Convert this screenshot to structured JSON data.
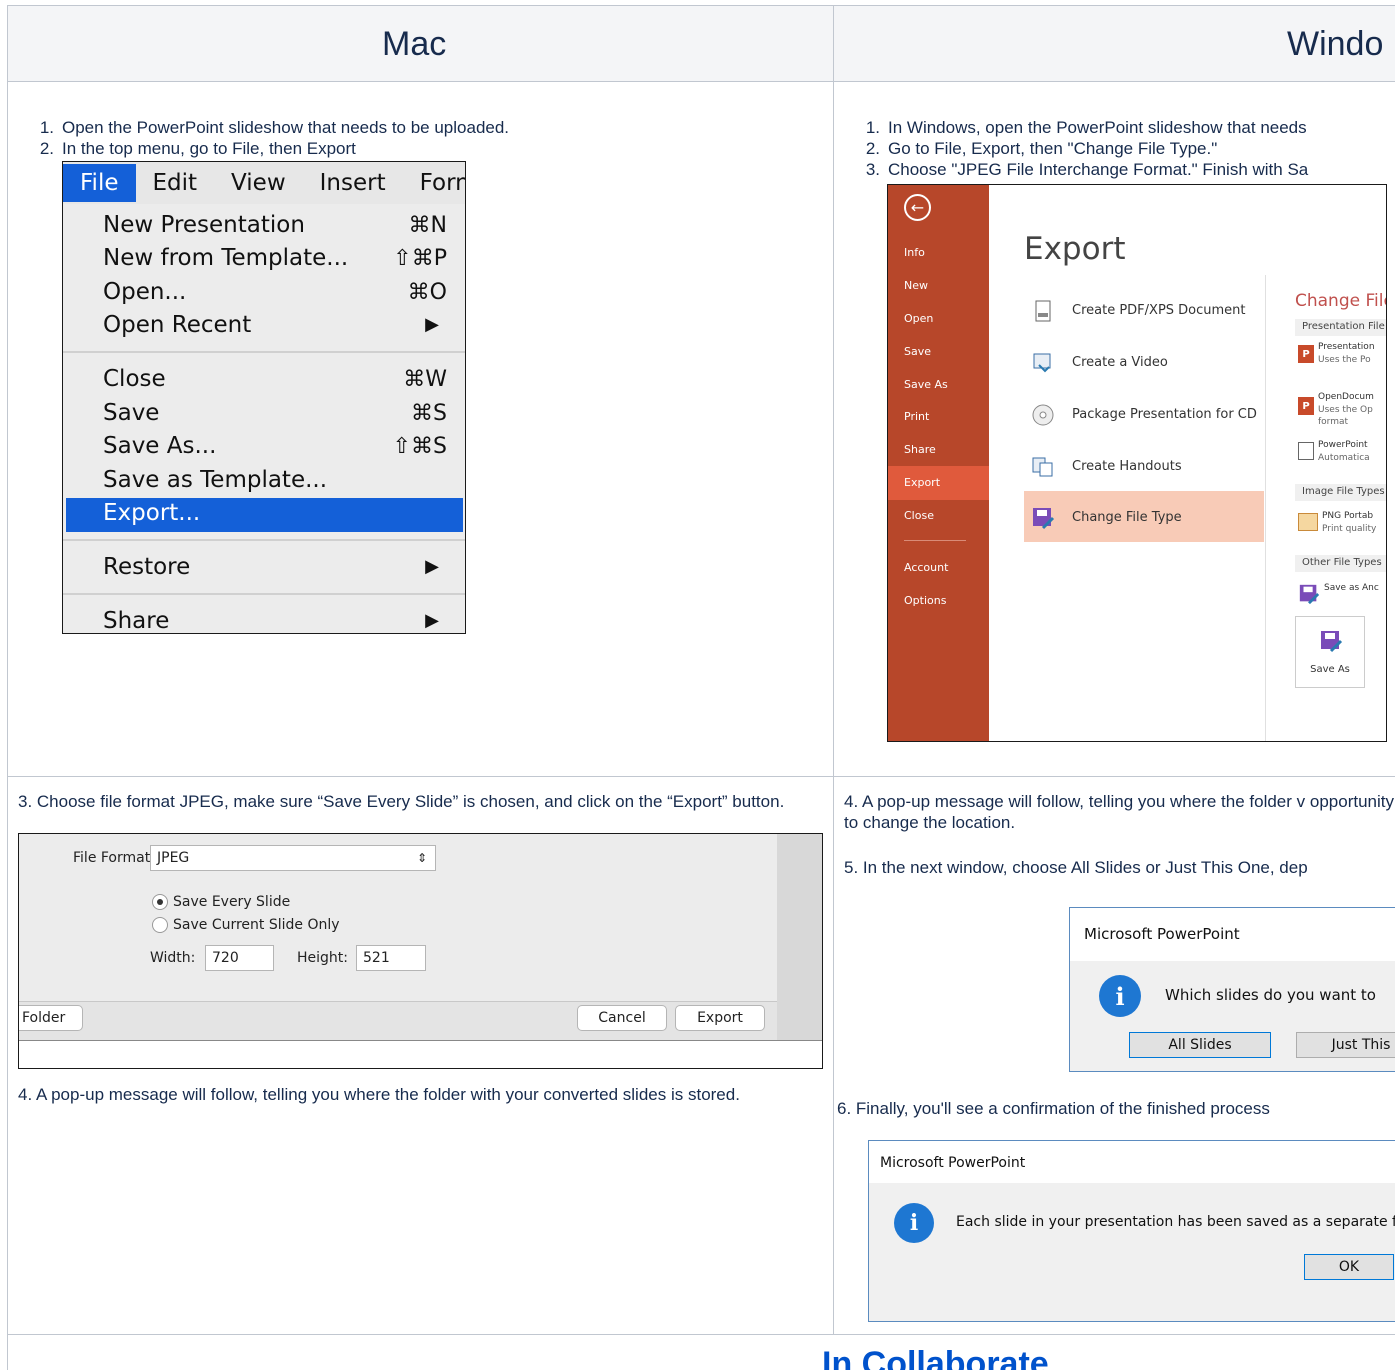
{
  "headers": {
    "mac": "Mac",
    "windows": "Windo"
  },
  "mac_steps": [
    {
      "num": "1.",
      "text": "Open the PowerPoint slideshow that needs to be uploaded."
    },
    {
      "num": "2.",
      "text": "In the top menu, go to File, then Export"
    }
  ],
  "mac_menu": {
    "bar": [
      "File",
      "Edit",
      "View",
      "Insert",
      "Forn"
    ],
    "items": [
      {
        "label": "New Presentation",
        "shortcut": "⌘N"
      },
      {
        "label": "New from Template...",
        "shortcut": "⇧⌘P"
      },
      {
        "label": "Open...",
        "shortcut": "⌘O"
      },
      {
        "label": "Open Recent",
        "shortcut": "▶"
      },
      {
        "label": "Close",
        "shortcut": "⌘W"
      },
      {
        "label": "Save",
        "shortcut": "⌘S"
      },
      {
        "label": "Save As...",
        "shortcut": "⇧⌘S"
      },
      {
        "label": "Save as Template...",
        "shortcut": ""
      },
      {
        "label": "Export...",
        "shortcut": ""
      },
      {
        "label": "Restore",
        "shortcut": "▶"
      },
      {
        "label": "Share",
        "shortcut": "▶"
      }
    ]
  },
  "win_steps": [
    {
      "num": "1.",
      "text": "In Windows, open the PowerPoint slideshow that needs"
    },
    {
      "num": "2.",
      "text": "Go to File, Export, then \"Change File Type.\""
    },
    {
      "num": "3.",
      "text": "Choose \"JPEG File Interchange Format.\" Finish with Sa"
    }
  ],
  "ppt": {
    "nav": [
      "Info",
      "New",
      "Open",
      "Save",
      "Save As",
      "Print",
      "Share",
      "Export",
      "Close",
      "Account",
      "Options"
    ],
    "title": "Export",
    "options": [
      "Create PDF/XPS Document",
      "Create a Video",
      "Package Presentation for CD",
      "Create Handouts",
      "Change File Type"
    ],
    "panel_title": "Change File",
    "presentation_types": "Presentation File",
    "pres_item": "Presentation",
    "pres_desc": "Uses the Po",
    "odp_item": "OpenDocum",
    "odp_desc": "Uses the Op",
    "odp_desc2": "format",
    "pps_item": "PowerPoint",
    "pps_desc": "Automatica",
    "image_types": "Image File Types",
    "png_item": "PNG Portab",
    "png_desc": "Print quality",
    "other_types": "Other File Types",
    "other_item": "Save as Anc",
    "save_as": "Save As"
  },
  "mac_step3": "3. Choose file format JPEG, make sure “Save Every Slide” is chosen, and click on the “Export” button.",
  "mac_dialog": {
    "format_label": "File Format:",
    "format_value": "JPEG",
    "radio1": "Save Every Slide",
    "radio2": "Save Current Slide Only",
    "width_label": "Width:",
    "width_value": "720",
    "height_label": "Height:",
    "height_value": "521",
    "folder_btn": "Folder",
    "cancel_btn": "Cancel",
    "export_btn": "Export"
  },
  "mac_step4": "4. A pop-up message will follow, telling you where the folder with your converted slides is stored.",
  "win_step4": "4. A pop-up message will follow, telling you where the folder v opportunity to change the location.",
  "win_step5": "5. In the next window, choose All Slides or Just This One, dep",
  "win_dialog1": {
    "title": "Microsoft PowerPoint",
    "message": "Which slides do you want to",
    "btn_all": "All Slides",
    "btn_this": "Just This"
  },
  "win_step6": "6. Finally, you'll see a confirmation of the finished process",
  "win_dialog2": {
    "title": "Microsoft PowerPoint",
    "message": "Each slide in your presentation has been saved as a separate file",
    "btn_ok": "OK"
  },
  "footer": {
    "link": "In Collaborate"
  }
}
